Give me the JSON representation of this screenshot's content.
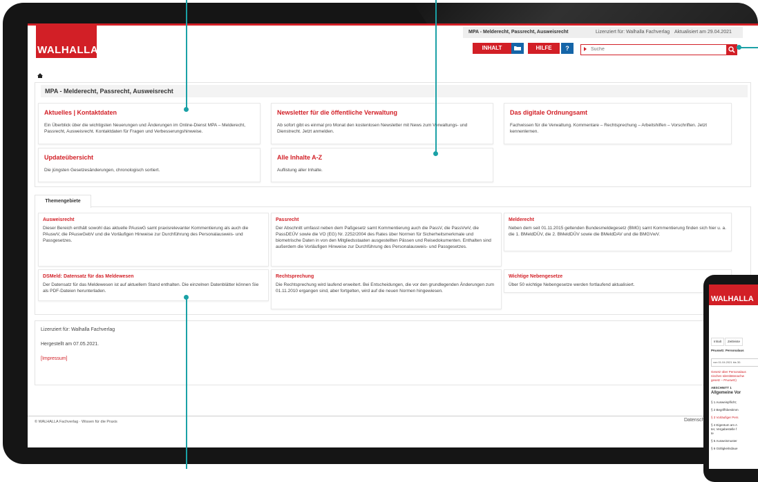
{
  "header": {
    "logo_text": "WALHALLA",
    "product_title": "MPA - Melderecht, Passrecht, Ausweisrecht",
    "licensed_text": "Lizenziert für: Walhalla Fachverlag",
    "updated_text": "Aktualisiert am 29.04.2021",
    "inhalt_label": "INHALT",
    "hilfe_label": "HILFE",
    "hilfe_icon_glyph": "?",
    "search_placeholder": "Suche"
  },
  "main": {
    "panel_title": "MPA - Melderecht, Passrecht, Ausweisrecht",
    "cards": [
      {
        "title": "Aktuelles | Kontaktdaten",
        "text": "Ein Überblick über die wichtigsten Neuerungen und Änderungen im Online-Dienst MPA – Melderecht, Passrecht, Ausweisrecht. Kontaktdaten für Fragen und Verbesserungshinweise."
      },
      {
        "title": "Newsletter für die öffentliche Verwaltung",
        "text": "Ab sofort gibt es einmal pro Monat den kostenlosen Newsletter mit News zum Verwaltungs- und Dienstrecht. Jetzt anmelden."
      },
      {
        "title": "Das digitale Ordnungsamt",
        "text": "Fachwissen für die Verwaltung. Kommentare – Rechtsprechung – Arbeitshilfen – Vorschriften. Jetzt kennenlernen."
      },
      {
        "title": "Updateübersicht",
        "text": "Die jüngsten Gesetzesänderungen, chronologisch sortiert."
      },
      {
        "title": "Alle Inhalte A-Z",
        "text": "Auflistung aller Inhalte."
      }
    ],
    "themen_tab": "Themengebiete",
    "themen": [
      {
        "title": "Ausweisrecht",
        "text": "Dieser Bereich enthält sowohl das aktuelle PAuswG samt praxisrelevanter Kommentierung als auch die PAuswV, die PAuswGebV und die Vorläufigen Hinweise zur Durchführung des Personalausweis- und Passgesetzes."
      },
      {
        "title": "Passrecht",
        "text": "Der Abschnitt umfasst neben dem Paßgesetz samt Kommentierung auch die PassV, die PassVwV, die PassDEÜV sowie die VO (EG) Nr. 2252/2004 des Rates über Normen für Sicherheitsmerkmale und biometrische Daten in von den Mitgliedsstaaten ausgestellten Pässen und Reisedokumenten. Enthalten sind außerdem die Vorläufigen Hinweise zur Durchführung des Personalausweis- und Passgesetzes."
      },
      {
        "title": "Melderecht",
        "text": "Neben dem seit 01.11.2015 geltenden Bundesmeldegesetz (BMG) samt Kommentierung finden sich hier u. a. die 1. BMeldDÜV, die 2. BMeldDÜV sowie die BMeldDAV und die BMGVwV."
      },
      {
        "title": "DSMeld: Datensatz für das Meldewesen",
        "text": "Der Datensatz für das Meldewesen ist auf aktuellem Stand enthalten. Die einzelnen Datenblätter können Sie als PDF-Dateien herunterladen."
      },
      {
        "title": "Rechtsprechung",
        "text": "Die Rechtsprechung wird laufend erweitert. Bei Entscheidungen, die vor den grundlegenden Änderungen zum 01.11.2010 ergangen sind, aber fortgelten, wird auf die neuen Normen hingewiesen."
      },
      {
        "title": "Wichtige Nebengesetze",
        "text": "Über 50 wichtige Nebengesetze werden fortlaufend aktualisiert."
      }
    ],
    "license_line": "Lizenziert für: Walhalla Fachverlag",
    "produced_line": "Hergestellt am 07.05.2021.",
    "impressum_link": "[Impressum]"
  },
  "footer": {
    "copyright": "© WALHALLA Fachverlag · Wissen für die Praxis",
    "datenschutz": "Datensch"
  },
  "phone": {
    "logo_text": "WALHALLA",
    "tab1": "Inhalt",
    "tab2": "Zeitleiste",
    "law_title": "PAuswG: Personalaus",
    "version_box": "von 01.04.2021 bis 30.",
    "intro_1": "Gesetz über Personalaus",
    "intro_2": "nischen Identitätsnachw",
    "intro_3": "gesetz – PAuswG)",
    "section_label": "ABSCHNITT 1",
    "section_title": "Allgemeine Vor",
    "items": [
      "§ 1 Ausweispflicht;",
      "§ 2 Begriffsbestimm",
      "§ 3 Vorläufiger Pers",
      "§ 4 Eigentum am A",
      "ter, Vergabestelle f",
      "te",
      "§ 5 Ausweismuster",
      "§ 6 Gültigkeitsdaue"
    ]
  },
  "colors": {
    "brand_red": "#d21f26",
    "accent_blue": "#1565a8",
    "connector_teal": "#1aa1a6"
  }
}
